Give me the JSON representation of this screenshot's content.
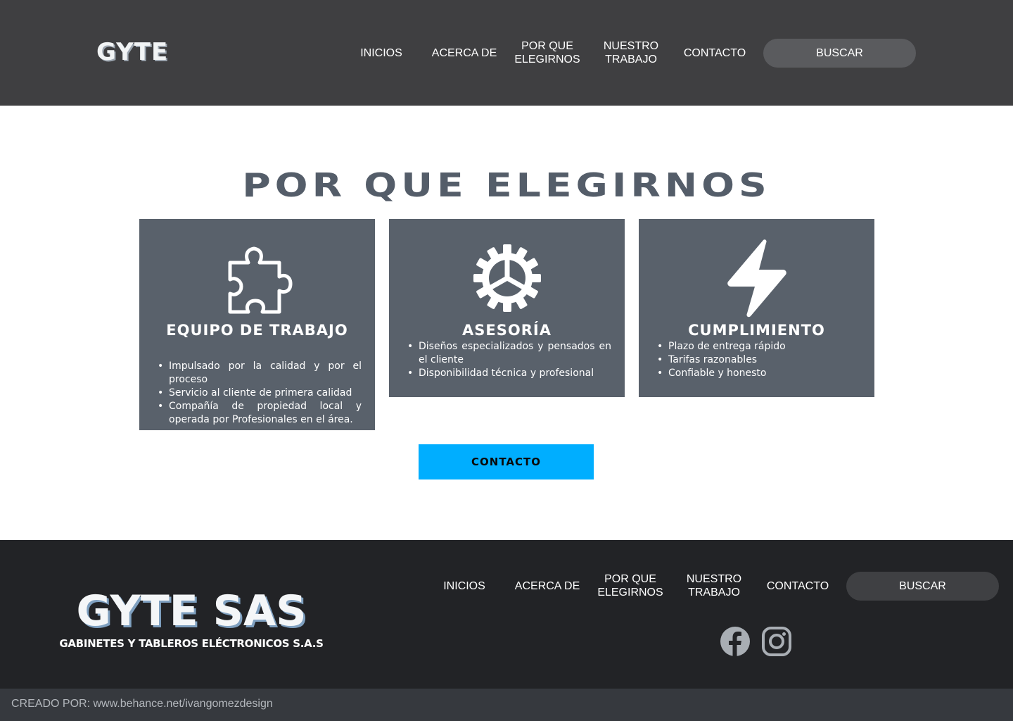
{
  "header": {
    "logo": "GYTE",
    "nav": [
      "INICIOS",
      "ACERCA DE",
      "POR QUE\nELEGIRNOS",
      "NUESTRO\nTRABAJO",
      "CONTACTO"
    ],
    "search_label": "BUSCAR"
  },
  "main": {
    "title": "POR QUE ELEGIRNOS",
    "cards": [
      {
        "icon": "puzzle-icon",
        "title": "EQUIPO DE TRABAJO",
        "items": [
          "Impulsado por la calidad y por el proceso",
          "Servicio al cliente de primera calidad",
          "Compañía de propiedad local y operada por Profesionales en el área."
        ]
      },
      {
        "icon": "gear-icon",
        "title": "ASESORÍA",
        "items": [
          "Diseños especializados y pensados en el cliente",
          "Disponibilidad técnica y profesional"
        ]
      },
      {
        "icon": "lightning-icon",
        "title": "CUMPLIMIENTO",
        "items": [
          "Plazo de entrega rápido",
          "Tarifas razonables",
          "Confiable y honesto"
        ]
      }
    ],
    "cta_label": "CONTACTO"
  },
  "footer": {
    "logo_main": "GYTE SAS",
    "logo_sub": "GABINETES Y TABLEROS ELÉCTRONICOS S.A.S",
    "nav": [
      "INICIOS",
      "ACERCA DE",
      "POR QUE\nELEGIRNOS",
      "NUESTRO\nTRABAJO",
      "CONTACTO"
    ],
    "search_label": "BUSCAR",
    "social": [
      "facebook-icon",
      "instagram-icon"
    ]
  },
  "credit": "CREADO POR: www.behance.net/ivangomezdesign",
  "colors": {
    "header_bg": "#3f3f41",
    "card_bg": "#59616b",
    "title": "#545d69",
    "accent": "#00aeff",
    "footer_bg": "#222326",
    "bottom_bar": "#36393e"
  }
}
